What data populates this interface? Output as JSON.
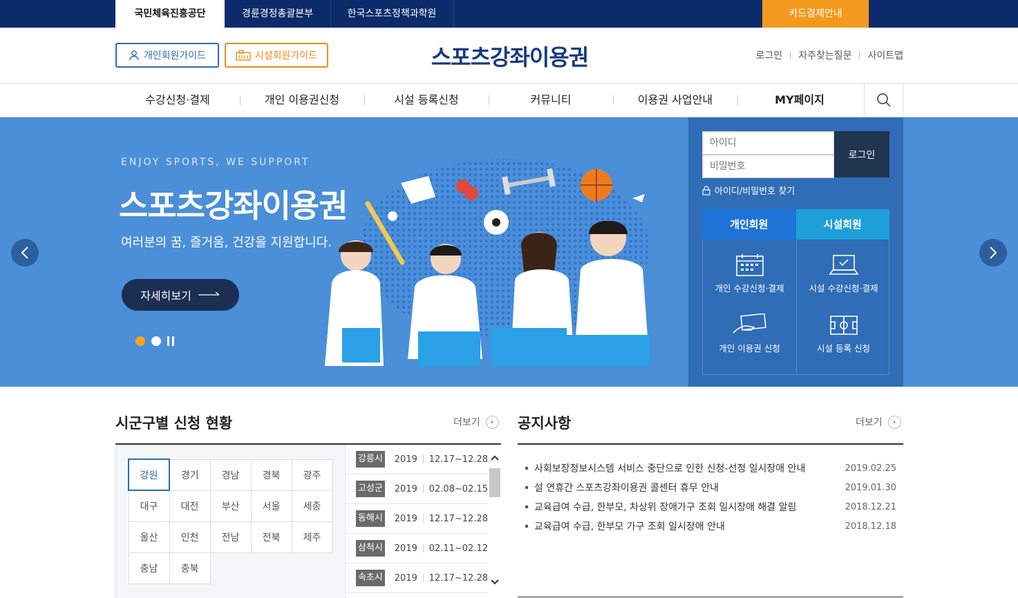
{
  "topbar": {
    "tabs": [
      "국민체육진흥공단",
      "경륜경정총괄본부",
      "한국스포츠정책과학원"
    ],
    "card_payment": "카드결제안내"
  },
  "header": {
    "person_guide": "개인회원가이드",
    "facility_guide": "시설회원가이드",
    "logo": "스포츠강좌이용권",
    "util": [
      "로그인",
      "자주찾는질문",
      "사이트맵"
    ]
  },
  "gnb": [
    "수강신청·결제",
    "개인 이용권신청",
    "시설 등록신청",
    "커뮤니티",
    "이용권 사업안내",
    "MY페이지"
  ],
  "hero": {
    "eyebrow": "ENJOY SPORTS, WE SUPPORT",
    "title": "스포츠강좌이용권",
    "subtitle": "여러분의 꿈, 즐거움, 건강을 지원합니다.",
    "more": "자세히보기"
  },
  "login": {
    "id_placeholder": "아이디",
    "pw_placeholder": "비밀번호",
    "button": "로그인",
    "find": "아이디/비밀번호 찾기",
    "tab_person": "개인회원",
    "tab_facility": "시설회원",
    "items": [
      "개인 수강신청·결제",
      "시설 수강신청·결제",
      "개인 이용권 신청",
      "시설 등록 신청"
    ]
  },
  "regions_section": {
    "title": "시군구별 신청 현황",
    "more": "더보기",
    "regions": [
      "강원",
      "경기",
      "경남",
      "경북",
      "광주",
      "대구",
      "대전",
      "부산",
      "서울",
      "세종",
      "울산",
      "인천",
      "전남",
      "전북",
      "제주",
      "충남",
      "충북"
    ],
    "selected": "강원",
    "schedule": [
      {
        "city": "강릉시",
        "year": "2019",
        "period": "12.17~12.28"
      },
      {
        "city": "고성군",
        "year": "2019",
        "period": "02.08~02.15"
      },
      {
        "city": "동해시",
        "year": "2019",
        "period": "12.17~12.28"
      },
      {
        "city": "삼척시",
        "year": "2019",
        "period": "02.11~02.12"
      },
      {
        "city": "속초시",
        "year": "2019",
        "period": "12.17~12.28"
      }
    ]
  },
  "notice_section": {
    "title": "공지사항",
    "more": "더보기",
    "items": [
      {
        "title": "사회보장정보시스템 서비스 중단으로 인한 신청-선정 일시장애 안내",
        "date": "2019.02.25"
      },
      {
        "title": "설 연휴간 스포츠강좌이용권 콜센터 휴무 안내",
        "date": "2019.01.30"
      },
      {
        "title": "교육급여 수급, 한부모, 차상위 장애가구 조회 일시장애 해결 알림",
        "date": "2018.12.21"
      },
      {
        "title": "교육급여 수급, 한부모 가구 조회 일시장애 안내",
        "date": "2018.12.18"
      }
    ]
  },
  "colors": {
    "navy": "#0c2b6b",
    "orange": "#f39a1e",
    "hero_blue": "#4a8fd8",
    "panel_blue": "#2f6db6"
  }
}
